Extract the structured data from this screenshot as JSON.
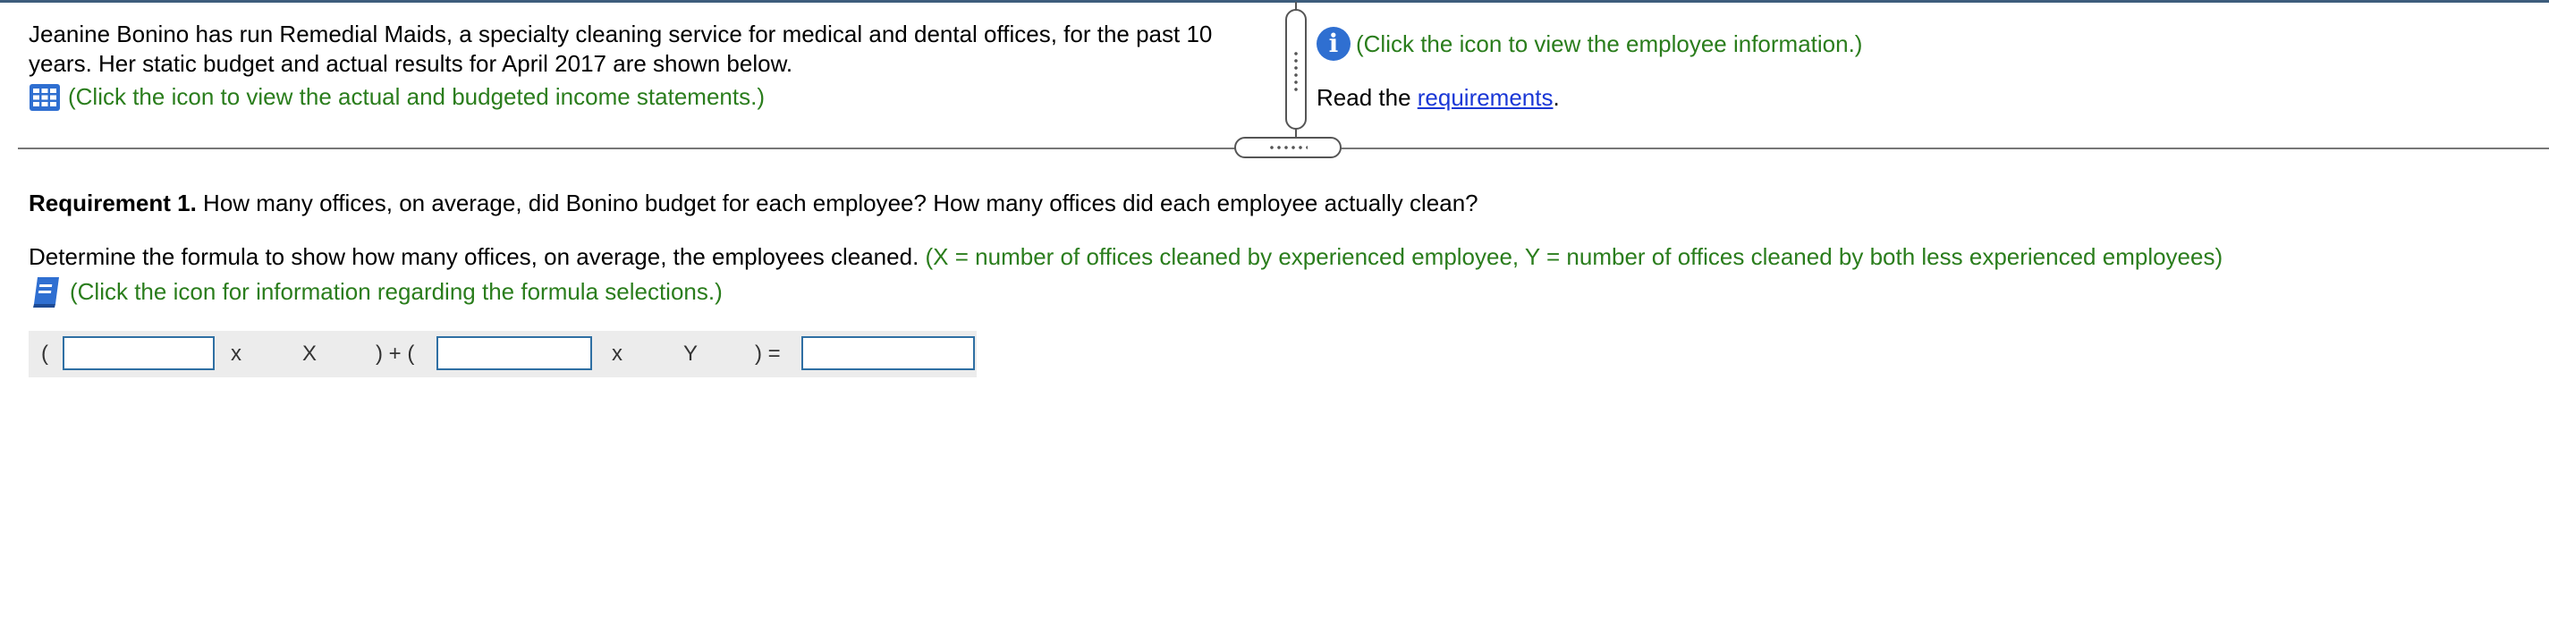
{
  "intro": {
    "text": "Jeanine Bonino has run Remedial Maids, a specialty cleaning service for medical and dental offices, for the past 10 years. Her static budget and actual results for April 2017 are shown below.",
    "statements_link": "(Click the icon to view the actual and budgeted income statements.)"
  },
  "info_panel": {
    "employee_link": "(Click the icon to view the employee information.)",
    "read_prefix": "Read the ",
    "requirements_link": "requirements",
    "read_suffix": "."
  },
  "requirement1": {
    "label": "Requirement 1.",
    "question": " How many offices, on average, did Bonino budget for each employee? How many offices did each employee actually clean?"
  },
  "formula": {
    "instruction": "Determine the formula to show how many offices, on average, the employees cleaned.",
    "hint": " (X = number of offices cleaned by experienced  employee, Y = number of offices cleaned by both less experienced employees)",
    "help_link": "(Click the icon for information regarding the formula selections.)",
    "open1": "(",
    "times1": "x",
    "var1": "X",
    "close_plus_open": ") + (",
    "times2": "x",
    "var2": "Y",
    "close_equals": ") =",
    "input1_value": "",
    "input2_value": "",
    "result_value": ""
  },
  "icons": {
    "statements": "spreadsheet-grid-icon",
    "info": "info-icon",
    "help": "book-icon"
  },
  "colors": {
    "hint_green": "#2a7d1c",
    "link_blue": "#1a37d6",
    "info_blue": "#2f6fd1",
    "input_border": "#2f6fa3"
  }
}
